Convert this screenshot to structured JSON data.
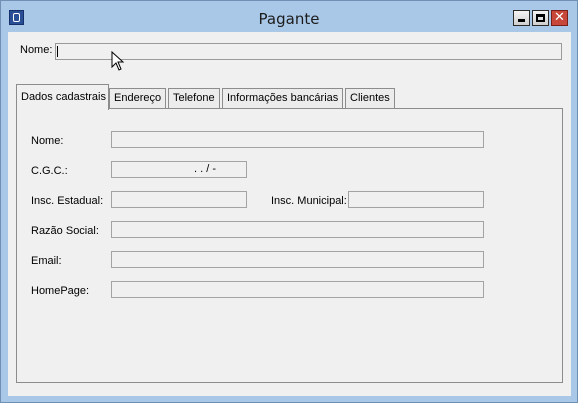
{
  "window": {
    "title": "Pagante",
    "close_glyph": "✕",
    "icons": {
      "app": "app-icon",
      "minimize": "minimize-icon",
      "maximize": "maximize-icon",
      "close": "close-icon"
    }
  },
  "header": {
    "name_label": "Nome:",
    "name_value": ""
  },
  "tabs": [
    {
      "label": "Dados cadastrais",
      "active": true
    },
    {
      "label": "Endereço"
    },
    {
      "label": "Telefone"
    },
    {
      "label": "Informações bancárias"
    },
    {
      "label": "Clientes"
    }
  ],
  "form": {
    "nome_label": "Nome:",
    "cgc_label": "C.G.C.:",
    "cgc_mask": ".    .    /     -",
    "insc_estadual_label": "Insc. Estadual:",
    "insc_municipal_label": "Insc. Municipal:",
    "razao_social_label": "Razão Social:",
    "email_label": "Email:",
    "homepage_label": "HomePage:"
  },
  "colors": {
    "window_frame": "#a9c8e8",
    "client_bg": "#f0f0f0",
    "close_button": "#c7483a"
  }
}
